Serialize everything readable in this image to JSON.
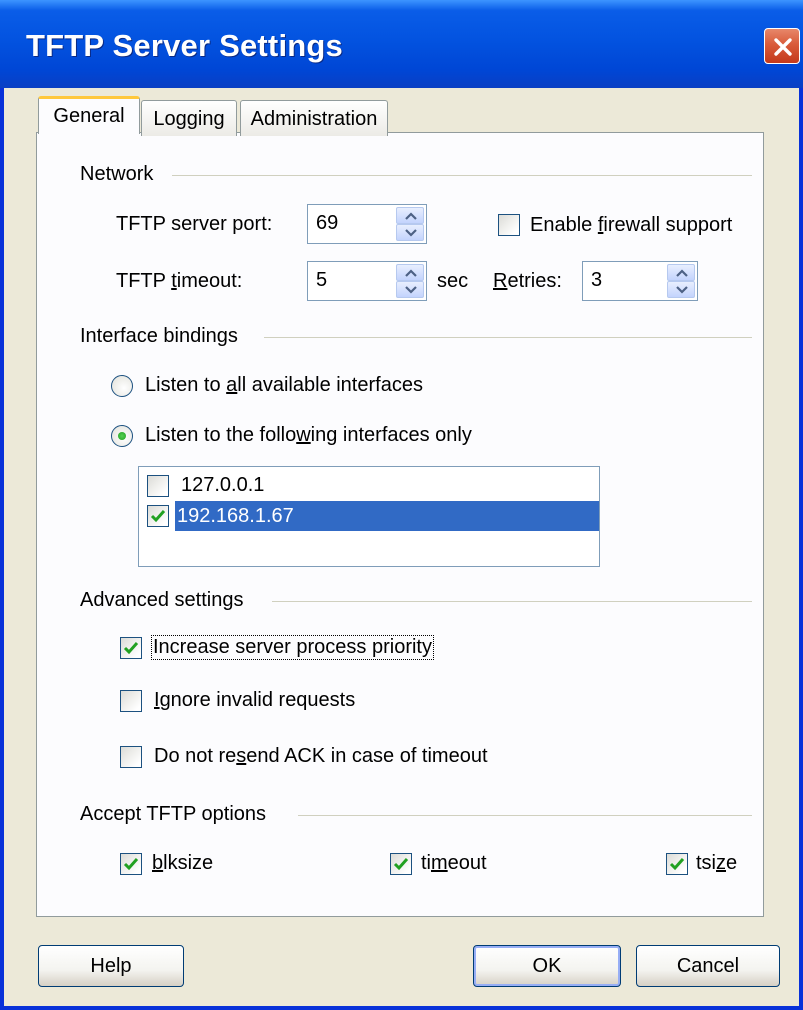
{
  "window": {
    "title": "TFTP Server Settings"
  },
  "tabs": [
    {
      "label": "General",
      "active": true
    },
    {
      "label": "Logging",
      "active": false
    },
    {
      "label": "Administration",
      "active": false
    }
  ],
  "network": {
    "group_label": "Network",
    "port_label": "TFTP server port:",
    "port_value": "69",
    "timeout_label": "TFTP timeout:",
    "timeout_value": "5",
    "timeout_unit": "sec",
    "retries_label": "Retries:",
    "retries_value": "3",
    "firewall_label": "Enable firewall support",
    "firewall_checked": false
  },
  "interface_bindings": {
    "group_label": "Interface bindings",
    "option_all": "Listen to all available interfaces",
    "option_following": "Listen to the following interfaces only",
    "selected_option": "following",
    "interfaces": [
      {
        "address": "127.0.0.1",
        "checked": false,
        "selected": false
      },
      {
        "address": "192.168.1.67",
        "checked": true,
        "selected": true
      }
    ]
  },
  "advanced": {
    "group_label": "Advanced settings",
    "increase_priority": {
      "label": "Increase server process priority",
      "checked": true
    },
    "ignore_invalid": {
      "label": "Ignore invalid requests",
      "checked": false
    },
    "no_resend_ack": {
      "label": "Do not resend ACK in case of timeout",
      "checked": false
    }
  },
  "tftp_options": {
    "group_label": "Accept TFTP options",
    "blksize": {
      "label": "blksize",
      "checked": true
    },
    "timeout": {
      "label": "timeout",
      "checked": true
    },
    "tsize": {
      "label": "tsize",
      "checked": true
    }
  },
  "buttons": {
    "help": "Help",
    "ok": "OK",
    "cancel": "Cancel"
  },
  "colors": {
    "titlebar": "#0a5de8",
    "selection": "#316ac5",
    "dialog_bg": "#ece9d8"
  }
}
